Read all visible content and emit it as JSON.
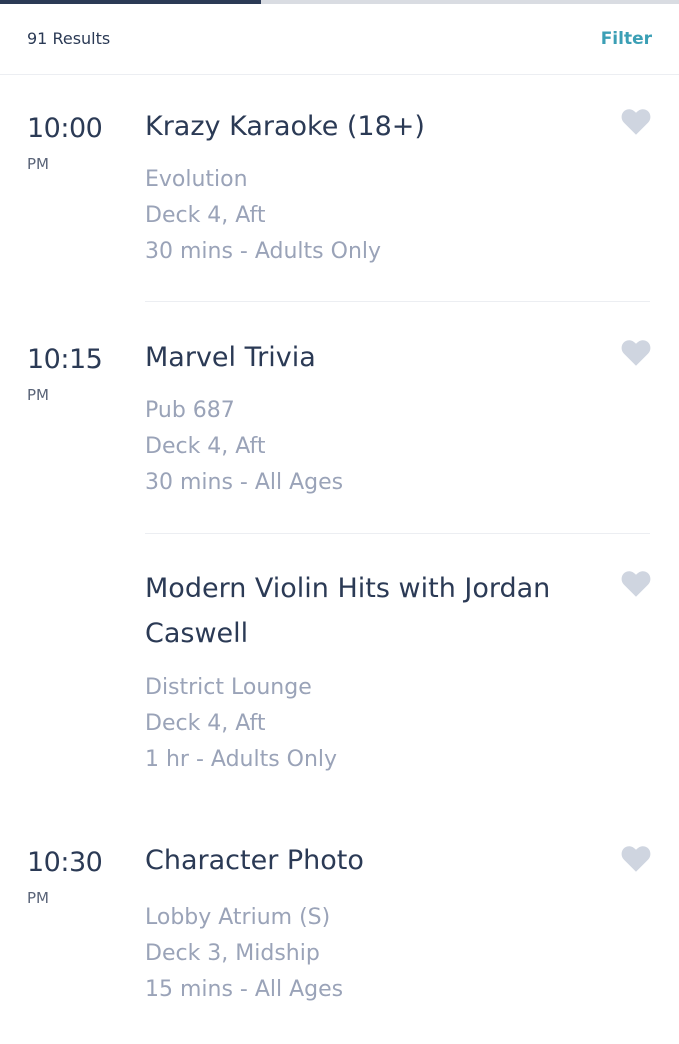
{
  "progress": {
    "fraction": 0.385
  },
  "header": {
    "results_label": "91 Results",
    "filter_label": "Filter"
  },
  "colors": {
    "accent": "#3b9fb5",
    "heart": "#cfd5e0",
    "title": "#2b3a55",
    "meta": "#9aa3b8"
  },
  "events": [
    {
      "time": "10:00",
      "ampm": "PM",
      "title": "Krazy Karaoke (18+)",
      "venue": "Evolution",
      "location": "Deck 4, Aft",
      "duration": "30 mins - Adults Only",
      "favorite_icon": "heart-icon"
    },
    {
      "time": "10:15",
      "ampm": "PM",
      "title": "Marvel Trivia",
      "venue": "Pub 687",
      "location": "Deck 4, Aft",
      "duration": "30 mins - All Ages",
      "favorite_icon": "heart-icon"
    },
    {
      "time": "",
      "ampm": "",
      "title": "Modern Violin Hits with Jordan Caswell",
      "venue": "District Lounge",
      "location": "Deck 4, Aft",
      "duration": "1 hr - Adults Only",
      "favorite_icon": "heart-icon"
    },
    {
      "time": "10:30",
      "ampm": "PM",
      "title": "Character Photo",
      "venue": "Lobby Atrium (S)",
      "location": "Deck 3, Midship",
      "duration": "15 mins - All Ages",
      "favorite_icon": "heart-icon"
    }
  ]
}
